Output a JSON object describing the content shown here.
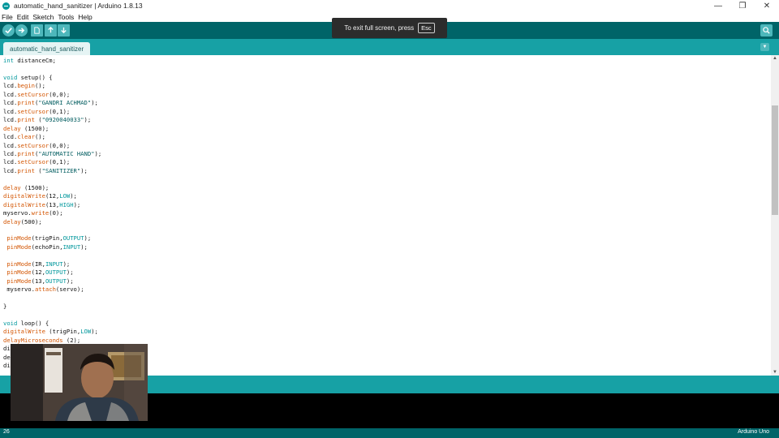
{
  "window": {
    "title": "automatic_hand_sanitizer | Arduino 1.8.13",
    "controls": [
      "—",
      "❐",
      "✕"
    ]
  },
  "menu": [
    "File",
    "Edit",
    "Sketch",
    "Tools",
    "Help"
  ],
  "toolbar": {
    "buttons": [
      {
        "name": "verify",
        "icon": "check-icon"
      },
      {
        "name": "upload",
        "icon": "arrow-right-icon"
      },
      {
        "name": "new",
        "icon": "new-file-icon"
      },
      {
        "name": "open",
        "icon": "open-icon"
      },
      {
        "name": "save",
        "icon": "save-icon"
      }
    ],
    "serial_monitor_icon": "magnifier-icon"
  },
  "fullscreen_notice": {
    "text": "To exit full screen, press",
    "key": "Esc"
  },
  "tabs": [
    {
      "label": "automatic_hand_sanitizer",
      "active": true
    }
  ],
  "code_lines": [
    "int distanceCm;",
    "",
    "void setup() {",
    "lcd.begin();",
    "lcd.setCursor(0,0);",
    "lcd.print(\"GANDRI ACHMAD\");",
    "lcd.setCursor(0,1);",
    "lcd.print (\"0920040033\");",
    "delay (1500);",
    "lcd.clear();",
    "lcd.setCursor(0,0);",
    "lcd.print(\"AUTOMATIC HAND\");",
    "lcd.setCursor(0,1);",
    "lcd.print (\"SANITIZER\");",
    "",
    "delay (1500);",
    "digitalWrite(12,LOW);",
    "digitalWrite(13,HIGH);",
    "myservo.write(0);",
    "delay(500);",
    "",
    " pinMode(trigPin,OUTPUT);",
    " pinMode(echoPin,INPUT);",
    "",
    " pinMode(IR,INPUT);",
    " pinMode(12,OUTPUT);",
    " pinMode(13,OUTPUT);",
    " myservo.attach(servo);",
    "",
    "}",
    "",
    "void loop() {",
    "digitalWrite (trigPin,LOW);",
    "delayMicroseconds (2);",
    "di",
    "de",
    "di"
  ],
  "status": {
    "line_number": "26",
    "board": "Arduino Uno"
  },
  "colors": {
    "toolbar": "#006468",
    "tabbar": "#17a1a5",
    "keyword": "#00979c",
    "function": "#d35400"
  }
}
